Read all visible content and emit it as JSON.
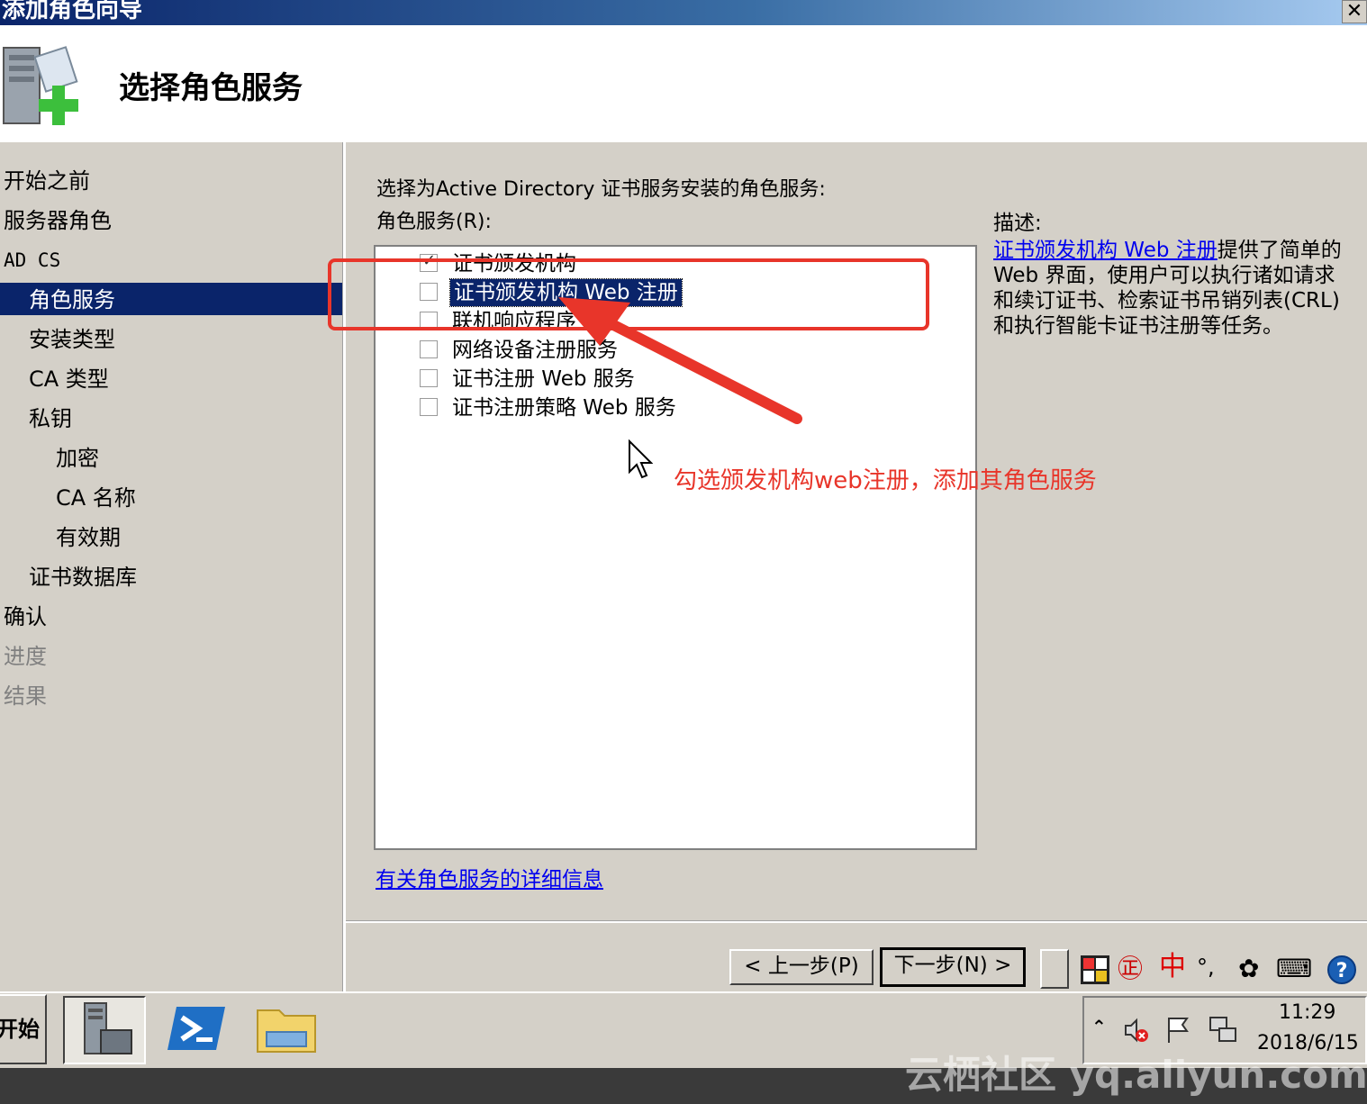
{
  "window": {
    "title": "添加角色向导",
    "close_glyph": "✕"
  },
  "header": {
    "page_title": "选择角色服务",
    "icon": "server-add-icon"
  },
  "nav": {
    "items": [
      {
        "label": "开始之前",
        "state": "normal"
      },
      {
        "label": "服务器角色",
        "state": "normal"
      },
      {
        "label": "AD CS",
        "state": "normal"
      },
      {
        "label": "角色服务",
        "state": "selected"
      },
      {
        "label": "安装类型",
        "state": "normal"
      },
      {
        "label": "CA 类型",
        "state": "normal"
      },
      {
        "label": "私钥",
        "state": "normal"
      },
      {
        "label": "加密",
        "state": "normal"
      },
      {
        "label": "CA 名称",
        "state": "normal"
      },
      {
        "label": "有效期",
        "state": "normal"
      },
      {
        "label": "证书数据库",
        "state": "normal"
      },
      {
        "label": "确认",
        "state": "normal"
      },
      {
        "label": "进度",
        "state": "dim"
      },
      {
        "label": "结果",
        "state": "dim"
      }
    ]
  },
  "main": {
    "instruction": "选择为Active Directory 证书服务安装的角色服务:",
    "list_label": "角色服务(R):",
    "role_services": [
      {
        "label": "证书颁发机构",
        "checked": true
      },
      {
        "label": "证书颁发机构 Web 注册",
        "checked": false,
        "selected": true
      },
      {
        "label": "联机响应程序",
        "checked": false
      },
      {
        "label": "网络设备注册服务",
        "checked": false
      },
      {
        "label": "证书注册 Web 服务",
        "checked": false
      },
      {
        "label": "证书注册策略 Web 服务",
        "checked": false
      }
    ],
    "more_info_link": "有关角色服务的详细信息",
    "description_label": "描述:",
    "description_link": "证书颁发机构 Web 注册",
    "description_text": "提供了简单的 Web 界面，使用户可以执行诸如请求和续订证书、检索证书吊销列表(CRL)和执行智能卡证书注册等任务。"
  },
  "buttons": {
    "back": "< 上一步(P)",
    "next": "下一步(N) >"
  },
  "ime_bar": {
    "mode": "中",
    "punct": "°,"
  },
  "taskbar": {
    "start": "开始"
  },
  "tray": {
    "time": "11:29",
    "date": "2018/6/15"
  },
  "annotation": {
    "text": "勾选颁发机构web注册，添加其角色服务",
    "color": "#e8352a"
  },
  "watermark": "云栖社区 yq.aliyun.com"
}
